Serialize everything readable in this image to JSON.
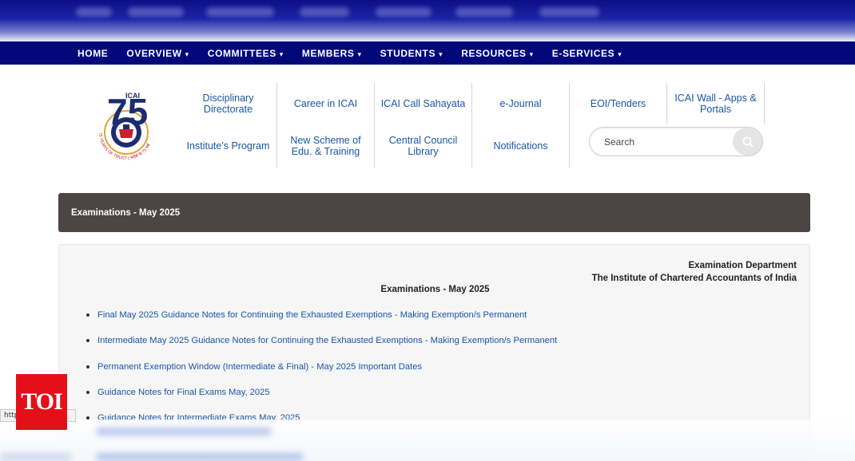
{
  "nav": {
    "items": [
      {
        "label": "HOME",
        "dropdown": false
      },
      {
        "label": "OVERVIEW",
        "dropdown": true
      },
      {
        "label": "COMMITTEES",
        "dropdown": true
      },
      {
        "label": "MEMBERS",
        "dropdown": true
      },
      {
        "label": "STUDENTS",
        "dropdown": true
      },
      {
        "label": "RESOURCES",
        "dropdown": true
      },
      {
        "label": "E-SERVICES",
        "dropdown": true
      }
    ],
    "caret": "▾"
  },
  "logo": {
    "top_text": "ICAI",
    "numeral": "75",
    "ring_text": "75 YEARS OF TRUST | भरोसे के 75 वर्ष",
    "colors": {
      "navy": "#1b2d6e",
      "red": "#c8202f",
      "gold": "#e1a23a"
    }
  },
  "quick_links": [
    "Disciplinary Directorate",
    "Career in ICAI",
    "ICAI Call Sahayata",
    "e-Journal",
    "EOI/Tenders",
    "ICAI Wall - Apps & Portals",
    "Institute's Program",
    "New Scheme of Edu. & Training",
    "Central Council Library",
    "Notifications"
  ],
  "search": {
    "placeholder": "Search",
    "icon": "search-icon"
  },
  "banner": {
    "title": "Examinations - May 2025"
  },
  "content": {
    "department": "Examination Department",
    "institute": "The Institute of Chartered Accountants of India",
    "title": "Examinations - May 2025",
    "items": [
      "Final May 2025 Guidance Notes for Continuing the Exhausted Exemptions - Making Exemption/s Permanent",
      "Intermediate May 2025 Guidance Notes for Continuing the Exhausted Exemptions - Making Exemption/s Permanent",
      "Permanent Exemption Window (Intermediate & Final) - May 2025 Important Dates",
      "Guidance Notes for Final Exams May, 2025",
      "Guidance Notes for Intermediate Exams May, 2025"
    ]
  },
  "status_bar": {
    "url": "http"
  },
  "watermark": {
    "label": "TOI",
    "color": "#e3101a"
  },
  "colors": {
    "nav_bg": "#02087a",
    "link": "#1a56a8",
    "banner_bg": "#4b4543"
  }
}
